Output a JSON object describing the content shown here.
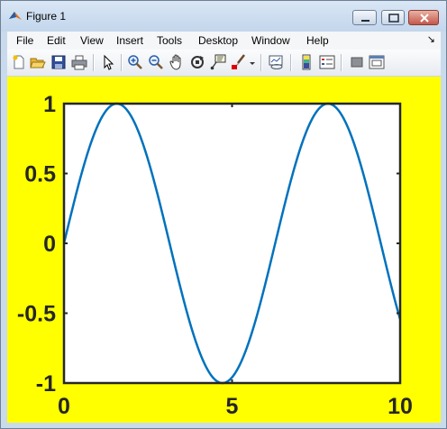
{
  "window": {
    "title": "Figure 1",
    "app_icon": "matlab-icon",
    "controls": [
      "minimize-icon",
      "maximize-icon",
      "close-icon"
    ]
  },
  "menu": {
    "items": [
      "File",
      "Edit",
      "View",
      "Insert",
      "Tools",
      "Desktop",
      "Window",
      "Help"
    ]
  },
  "toolbar": {
    "buttons": [
      "new-figure-icon",
      "open-file-icon",
      "save-icon",
      "print-icon",
      "edit-plot-icon",
      "zoom-in-icon",
      "zoom-out-icon",
      "pan-icon",
      "rotate-3d-icon",
      "data-cursor-icon",
      "brush-icon",
      "brush-dropdown-icon",
      "link-plot-icon",
      "insert-colorbar-icon",
      "insert-legend-icon",
      "hide-plot-tools-icon",
      "show-plot-tools-icon"
    ]
  },
  "figure": {
    "background": "#ffff00"
  },
  "chart_data": {
    "type": "line",
    "title": "",
    "xlabel": "",
    "ylabel": "",
    "xlim": [
      0,
      10
    ],
    "ylim": [
      -1,
      1
    ],
    "xticks": [
      "0",
      "5",
      "10"
    ],
    "yticks": [
      "-1",
      "-0.5",
      "0",
      "0.5",
      "1"
    ],
    "grid": false,
    "series": [
      {
        "color": "#0072bd",
        "x": [
          0,
          0.5,
          1,
          1.5,
          2,
          2.5,
          3,
          3.5,
          4,
          4.5,
          5,
          5.5,
          6,
          6.5,
          7,
          7.5,
          8,
          8.5,
          9,
          9.5,
          10
        ],
        "y": [
          0,
          0.48,
          0.84,
          1.0,
          0.91,
          0.6,
          0.14,
          -0.35,
          -0.76,
          -0.98,
          -0.96,
          -0.71,
          -0.28,
          0.22,
          0.66,
          0.94,
          0.99,
          0.8,
          0.41,
          -0.08,
          -0.54
        ]
      }
    ]
  }
}
